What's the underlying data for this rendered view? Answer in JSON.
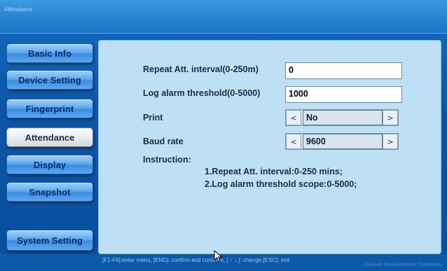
{
  "window": {
    "title": "Attendance"
  },
  "sidebar": {
    "items": [
      {
        "label": "Basic Info",
        "active": false
      },
      {
        "label": "Device Setting",
        "active": false
      },
      {
        "label": "Fingerprint",
        "active": false
      },
      {
        "label": "Attendance",
        "active": true
      },
      {
        "label": "Display",
        "active": false
      },
      {
        "label": "Snapshot",
        "active": false
      }
    ],
    "system_setting_label": "System Setting"
  },
  "form": {
    "repeat_interval": {
      "label": "Repeat Att. interval(0-250m)",
      "value": "0"
    },
    "log_alarm": {
      "label": "Log alarm threshold(0-5000)",
      "value": "1000"
    },
    "print": {
      "label": "Print",
      "value": "No"
    },
    "baud_rate": {
      "label": "Baud rate",
      "value": "9600"
    },
    "instruction": {
      "label": "Instruction:",
      "lines": [
        "1.Repeat Att. interval:0-250 mins;",
        "2.Log alarm threshold scope:0-5000;"
      ]
    }
  },
  "selector_arrows": {
    "left": "<",
    "right": ">"
  },
  "status": {
    "hint": "[F1-F6]:enter menu, [END]: confirm and continue, [ ↑ ↓ ]: change,[ESC]: exit",
    "brand": "GA3000 FINGERPRINT TERMINAL"
  },
  "colors": {
    "background": "#0d5ca8",
    "panel": "#bde0f5",
    "button_blue": "#5ea7ee",
    "button_active": "#e9edf1"
  },
  "icons": {
    "cursor": "mouse-pointer-icon"
  }
}
